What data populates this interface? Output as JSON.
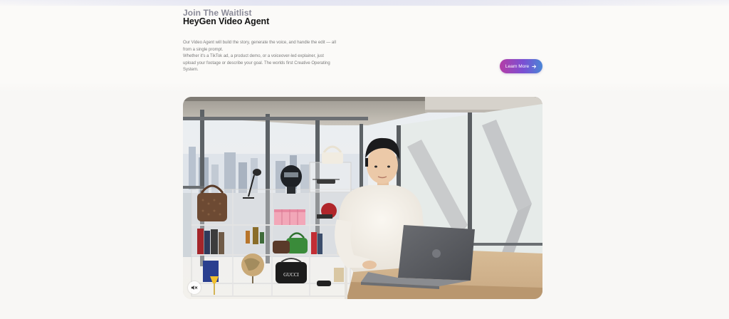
{
  "hero": {
    "eyebrow": "Join The Waitlist",
    "title": "HeyGen Video Agent",
    "description": [
      "Our Video Agent will build the story, generate the voice, and handle the edit — all from a single prompt.",
      "Whether it's a TikTok ad, a product demo, or a voiceover-led explainer, just upload your footage or describe your goal. The worlds first Creative Operating System."
    ],
    "cta_label": "Learn More",
    "cta_icon": "arrow-right-icon",
    "cta_gradient": [
      "#b43da6",
      "#7a4fd3",
      "#4a86d6"
    ]
  },
  "video": {
    "mute_icon": "speaker-muted-icon",
    "gucci_text": "GUCCI"
  }
}
